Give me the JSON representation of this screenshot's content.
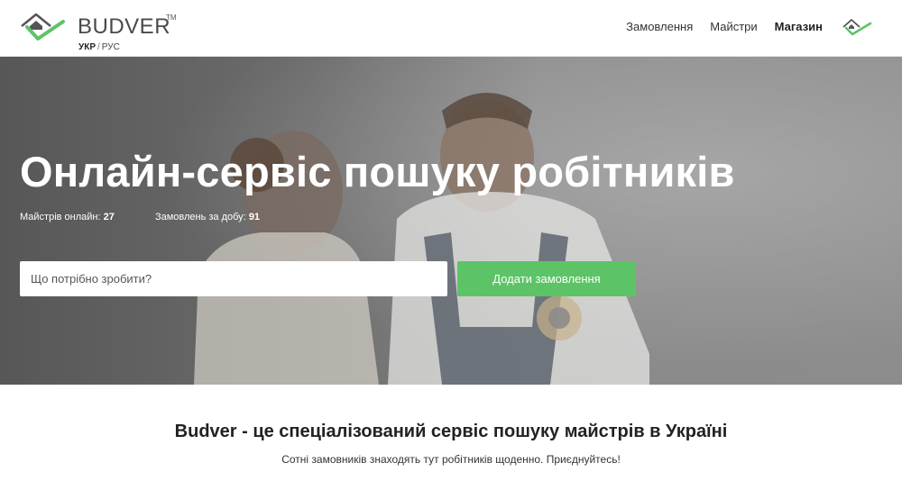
{
  "header": {
    "brand": "BUDVER",
    "trademark": "TM",
    "lang": {
      "active": "УКР",
      "separator": "/",
      "other": "РУС"
    },
    "nav": [
      "Замовлення",
      "Майстри",
      "Магазин"
    ],
    "logo_icon": "house-check-logo-icon",
    "logo_colors": {
      "house": "#555555",
      "check": "#5cc466"
    }
  },
  "hero": {
    "title": "Онлайн-сервіс пошуку робітників",
    "stats": [
      {
        "label": "Майстрів онлайн:",
        "value": "27"
      },
      {
        "label": "Замовлень за добу:",
        "value": "91"
      }
    ],
    "search_placeholder": "Що потрібно зробити?",
    "cta_label": "Додати замовлення",
    "cta_color": "#5cc466"
  },
  "intro": {
    "title": "Budver - це спеціалізований сервіс пошуку майстрів в Україні",
    "subtitle": "Сотні замовників знаходять тут робітників щоденно. Приєднуйтесь!"
  }
}
